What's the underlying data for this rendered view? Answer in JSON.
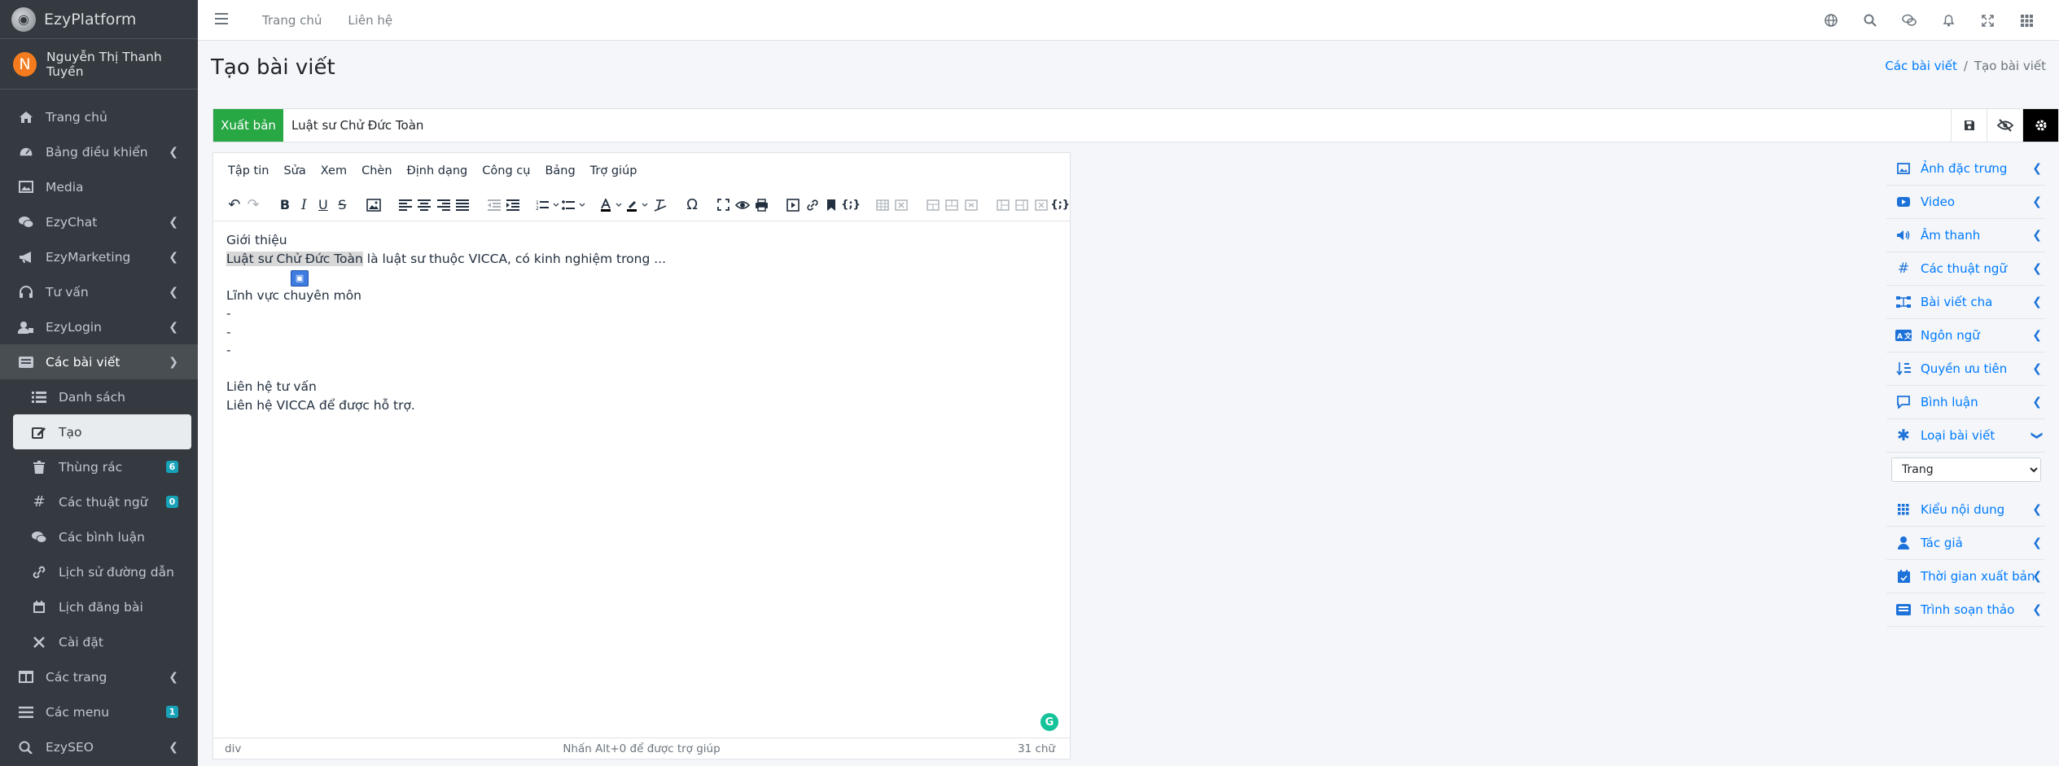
{
  "brand": {
    "name": "EzyPlatform"
  },
  "user": {
    "initial": "N",
    "name": "Nguyễn Thị Thanh Tuyền"
  },
  "sidebar": {
    "items": [
      {
        "label": "Trang chủ"
      },
      {
        "label": "Bảng điều khiển"
      },
      {
        "label": "Media"
      },
      {
        "label": "EzyChat"
      },
      {
        "label": "EzyMarketing"
      },
      {
        "label": "Tư vấn"
      },
      {
        "label": "EzyLogin"
      },
      {
        "label": "Các bài viết"
      },
      {
        "label": "Danh sách"
      },
      {
        "label": "Tạo"
      },
      {
        "label": "Thùng rác",
        "badge": "6"
      },
      {
        "label": "Các thuật ngữ",
        "badge": "0"
      },
      {
        "label": "Các bình luận"
      },
      {
        "label": "Lịch sử đường dẫn"
      },
      {
        "label": "Lịch đăng bài"
      },
      {
        "label": "Cài đặt"
      },
      {
        "label": "Các trang"
      },
      {
        "label": "Các menu",
        "badge": "1"
      },
      {
        "label": "EzySEO"
      }
    ]
  },
  "topbar": {
    "links": [
      "Trang chủ",
      "Liên hệ"
    ]
  },
  "header": {
    "title": "Tạo bài viết",
    "breadcrumb": [
      "Các bài viết",
      "/",
      "Tạo bài viết"
    ]
  },
  "post": {
    "publish_label": "Xuất bản",
    "title_value": "Luật sư Chử Đức Toàn"
  },
  "editor": {
    "menu": [
      "Tập tin",
      "Sửa",
      "Xem",
      "Chèn",
      "Định dạng",
      "Công cụ",
      "Bảng",
      "Trợ giúp"
    ],
    "lines": {
      "l1": "Giới thiệu",
      "l2_hl": "Luật sư Chử Đức Toàn",
      "l2_rest": " là luật sư thuộc VICCA, có kinh nghiệm trong ...",
      "l4": "Lĩnh vực chuyên môn",
      "l5": "-",
      "l6": "-",
      "l7": "-",
      "l9": "Liên hệ tư vấn",
      "l10": "Liên hệ VICCA để được hỗ trợ."
    },
    "status": {
      "path": "div",
      "help": "Nhấn Alt+0 để được trợ giúp",
      "count": "31 chữ"
    }
  },
  "rightpanel": {
    "items": [
      "Ảnh đặc trưng",
      "Video",
      "Âm thanh",
      "Các thuật ngữ",
      "Bài viết cha",
      "Ngôn ngữ",
      "Quyền ưu tiên",
      "Bình luận",
      "Loại bài viết"
    ],
    "type_select": "Trang",
    "items2": [
      "Kiểu nội dung",
      "Tác giả",
      "Thời gian xuất bản",
      "Trình soạn thảo"
    ]
  },
  "colors": {
    "sidebar_bg": "#343a40",
    "publish": "#28a745",
    "link": "#007bff",
    "badge": "#17a2b8",
    "avatar": "#f47c1e"
  }
}
